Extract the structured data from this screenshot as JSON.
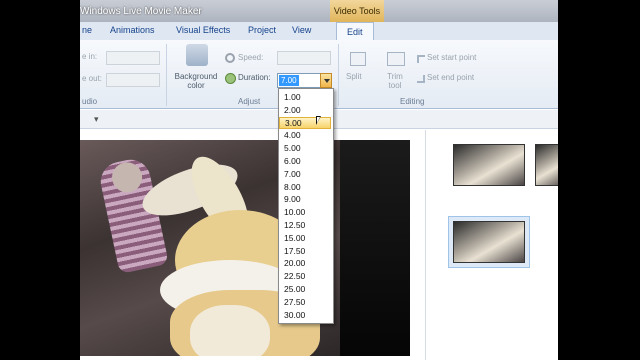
{
  "window": {
    "title": "Windows Live Movie Maker"
  },
  "contextual_tab": {
    "label": "Video Tools"
  },
  "ribbon_tabs": {
    "home": "ne",
    "animations": "Animations",
    "visual_effects": "Visual Effects",
    "project": "Project",
    "view": "View",
    "edit": "Edit"
  },
  "ribbon": {
    "fade_in_label": "e in:",
    "fade_out_label": "e out:",
    "audio_group_label": "udio",
    "background_color_label": "Background color",
    "speed_label": "Speed:",
    "duration_label": "Duration:",
    "duration_value": "7.00",
    "adjust_group_label": "Adjust",
    "split_label": "Split",
    "trim_tool_label": "Trim tool",
    "set_start_point_label": "Set start point",
    "set_end_point_label": "Set end point",
    "editing_group_label": "Editing"
  },
  "duration_dropdown": {
    "selected": "3.00",
    "options": [
      "1.00",
      "2.00",
      "3.00",
      "4.00",
      "5.00",
      "6.00",
      "7.00",
      "8.00",
      "9.00",
      "10.00",
      "12.50",
      "15.00",
      "17.50",
      "20.00",
      "22.50",
      "25.00",
      "27.50",
      "30.00"
    ]
  },
  "icons": {
    "background_color": "paint-bucket-icon",
    "speed": "speedometer-icon",
    "duration": "clock-icon",
    "split": "split-icon",
    "trim": "trim-icon",
    "set_start": "set-start-icon",
    "set_end": "set-end-icon"
  },
  "colors": {
    "accent_selection": "#3399ff",
    "hover_highlight": "#f7d36a",
    "contextual_tab": "#e0b55a"
  }
}
